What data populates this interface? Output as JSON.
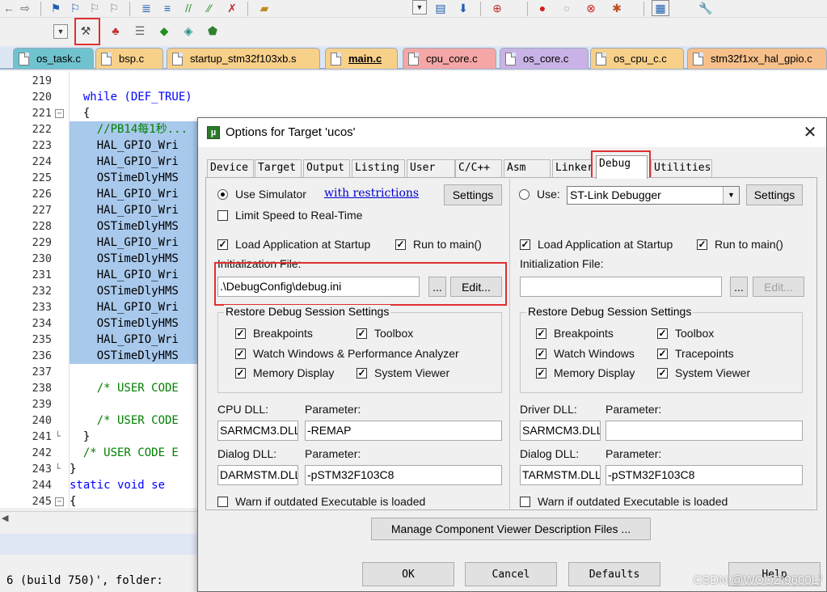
{
  "editor": {
    "tabs": [
      {
        "label": "os_task.c",
        "color": "#6fc3ce"
      },
      {
        "label": "bsp.c",
        "color": "#f7d08a"
      },
      {
        "label": "startup_stm32f103xb.s",
        "color": "#f7d08a"
      },
      {
        "label": "main.c",
        "color": "#f7d08a"
      },
      {
        "label": "cpu_core.c",
        "color": "#f5a6a6"
      },
      {
        "label": "os_core.c",
        "color": "#c9b3e6"
      },
      {
        "label": "os_cpu_c.c",
        "color": "#f7d08a"
      },
      {
        "label": "stm32f1xx_hal_gpio.c",
        "color": "#f7c08a"
      }
    ],
    "active_tab": "main.c",
    "line_numbers": [
      "219",
      "220",
      "221",
      "222",
      "223",
      "224",
      "225",
      "226",
      "227",
      "228",
      "229",
      "230",
      "231",
      "232",
      "233",
      "234",
      "235",
      "236",
      "237",
      "238",
      "239",
      "240",
      "241",
      "242",
      "243",
      "244",
      "245"
    ],
    "lines": [
      "",
      "  while (DEF_TRUE)",
      "  {",
      "    //PB14每1秒...",
      "    HAL_GPIO_Wri",
      "    HAL_GPIO_Wri",
      "    OSTimeDlyHMS",
      "    HAL_GPIO_Wri",
      "    HAL_GPIO_Wri",
      "    OSTimeDlyHMS",
      "    HAL_GPIO_Wri",
      "    OSTimeDlyHMS",
      "    HAL_GPIO_Wri",
      "    OSTimeDlyHMS",
      "    HAL_GPIO_Wri",
      "    OSTimeDlyHMS",
      "    HAL_GPIO_Wri",
      "    OSTimeDlyHMS",
      "",
      "    /* USER CODE",
      "",
      "    /* USER CODE",
      "  }",
      "  /* USER CODE E",
      "}",
      "static void se",
      "{"
    ],
    "bottom_status": "6 (build 750)', folder:"
  },
  "dialog": {
    "title": "Options for Target 'ucos'",
    "close_glyph": "✕",
    "tabs": [
      "Device",
      "Target",
      "Output",
      "Listing",
      "User",
      "C/C++",
      "Asm",
      "Linker",
      "Debug",
      "Utilities"
    ],
    "active_tab": "Debug",
    "left": {
      "use_simulator": "Use Simulator",
      "restrictions_link": "with restrictions",
      "settings": "Settings",
      "limit_speed": "Limit Speed to Real-Time",
      "load_app": "Load Application at Startup",
      "run_to_main": "Run to main()",
      "init_file_label": "Initialization File:",
      "init_file_value": ".\\DebugConfig\\debug.ini",
      "browse": "...",
      "edit": "Edit...",
      "restore_title": "Restore Debug Session Settings",
      "breakpoints": "Breakpoints",
      "toolbox": "Toolbox",
      "watch_windows": "Watch Windows & Performance Analyzer",
      "memory_display": "Memory Display",
      "system_viewer": "System Viewer",
      "cpu_dll_label": "CPU DLL:",
      "parameter_label": "Parameter:",
      "cpu_dll": "SARMCM3.DLL",
      "cpu_param": "-REMAP",
      "dialog_dll_label": "Dialog DLL:",
      "dialog_dll": "DARMSTM.DLL",
      "dialog_param": "-pSTM32F103C8",
      "warn_outdated": "Warn if outdated Executable is loaded"
    },
    "right": {
      "use": "Use:",
      "debugger": "ST-Link Debugger",
      "settings": "Settings",
      "load_app": "Load Application at Startup",
      "run_to_main": "Run to main()",
      "init_file_label": "Initialization File:",
      "init_file_value": "",
      "browse": "...",
      "edit": "Edit...",
      "restore_title": "Restore Debug Session Settings",
      "breakpoints": "Breakpoints",
      "toolbox": "Toolbox",
      "watch_windows": "Watch Windows",
      "tracepoints": "Tracepoints",
      "memory_display": "Memory Display",
      "system_viewer": "System Viewer",
      "driver_dll_label": "Driver DLL:",
      "parameter_label": "Parameter:",
      "driver_dll": "SARMCM3.DLL",
      "driver_param": "",
      "dialog_dll_label": "Dialog DLL:",
      "dialog_dll": "TARMSTM.DLL",
      "dialog_param": "-pSTM32F103C8",
      "warn_outdated": "Warn if outdated Executable is loaded"
    },
    "manage_button": "Manage Component Viewer Description Files ...",
    "footer": {
      "ok": "OK",
      "cancel": "Cancel",
      "defaults": "Defaults",
      "help": "Help"
    }
  },
  "watermark": "CSDN @WOOZI9600L²",
  "highlight_color": "#e03030",
  "selection_color": "#a9c9ec"
}
